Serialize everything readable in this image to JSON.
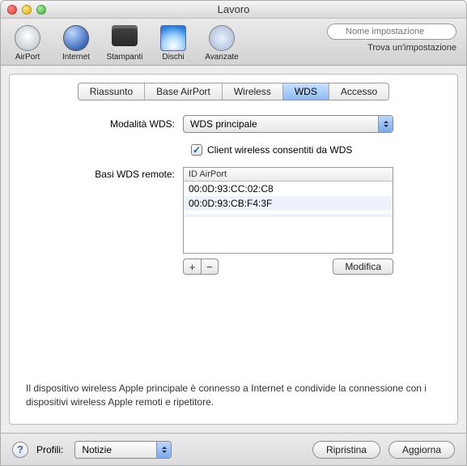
{
  "window": {
    "title": "Lavoro"
  },
  "toolbar": {
    "items": [
      {
        "label": "AirPort"
      },
      {
        "label": "Internet"
      },
      {
        "label": "Stampanti"
      },
      {
        "label": "Dischi"
      },
      {
        "label": "Avanzate"
      }
    ],
    "search_placeholder": "Nome impostazione",
    "find_label": "Trova un'impostazione"
  },
  "tabs": {
    "items": [
      {
        "label": "Riassunto"
      },
      {
        "label": "Base AirPort"
      },
      {
        "label": "Wireless"
      },
      {
        "label": "WDS"
      },
      {
        "label": "Accesso"
      }
    ],
    "selected": "WDS"
  },
  "form": {
    "mode_label": "Modalità WDS:",
    "mode_value": "WDS principale",
    "allow_clients_label": "Client wireless consentiti da WDS",
    "remotes_label": "Basi WDS remote:",
    "list_header": "ID AirPort",
    "list_rows": [
      "00:0D:93:CC:02:C8",
      "00:0D:93:CB:F4:3F"
    ],
    "add_label": "+",
    "remove_label": "−",
    "modify_label": "Modifica"
  },
  "info_text": "Il dispositivo wireless Apple principale è connesso a Internet e condivide la connessione con i dispositivi wireless Apple remoti e ripetitore.",
  "footer": {
    "profiles_label": "Profili:",
    "profiles_value": "Notizie",
    "restore_label": "Ripristina",
    "update_label": "Aggiorna",
    "help_label": "?"
  }
}
